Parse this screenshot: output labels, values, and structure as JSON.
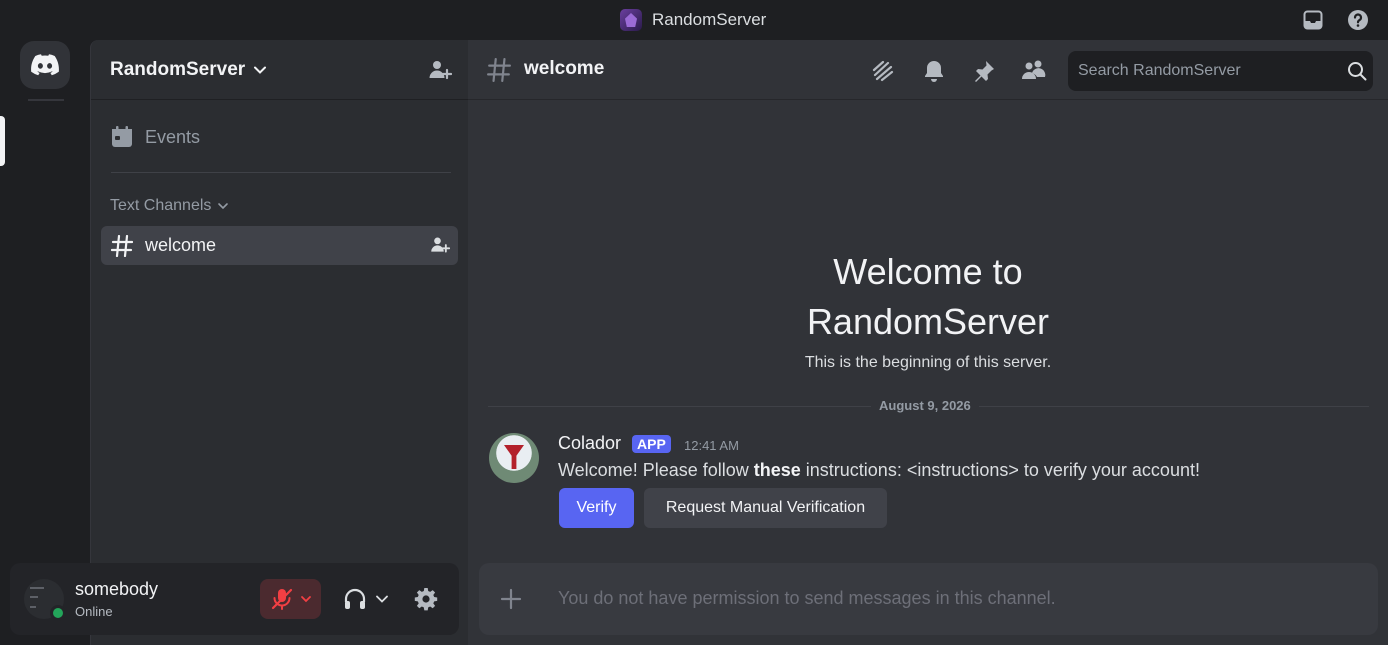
{
  "window": {
    "title": "RandomServer"
  },
  "sidebar": {
    "guild_name": "RandomServer",
    "events_label": "Events",
    "category_label": "Text Channels",
    "channels": [
      {
        "name": "welcome"
      }
    ]
  },
  "user_panel": {
    "username": "somebody",
    "status": "Online"
  },
  "channel_header": {
    "name": "welcome",
    "search_placeholder": "Search RandomServer"
  },
  "welcome": {
    "title_line1": "Welcome to",
    "title_line2": "RandomServer",
    "subtitle": "This is the beginning of this server."
  },
  "messages": [
    {
      "date_divider": "August 9, 2026",
      "author": "Colador",
      "badge": "APP",
      "time": "12:41 AM",
      "text_before": "Welcome! Please follow ",
      "text_bold": "these",
      "text_after": " instructions: <instructions> to verify your account!",
      "buttons": [
        "Verify",
        "Request Manual Verification"
      ]
    }
  ],
  "composer": {
    "placeholder": "You do not have permission to send messages in this channel."
  },
  "colors": {
    "accent": "#5865f2",
    "online": "#23a55a",
    "danger": "#f23f43"
  },
  "icons": [
    "server-icon",
    "inbox-icon",
    "help-icon",
    "discord-logo-icon",
    "chevron-down-icon",
    "add-member-icon",
    "calendar-icon",
    "hash-icon",
    "muted-mic-icon",
    "headphones-icon",
    "gear-icon",
    "threads-icon",
    "bell-icon",
    "pin-icon",
    "members-icon",
    "search-icon",
    "plus-icon"
  ]
}
